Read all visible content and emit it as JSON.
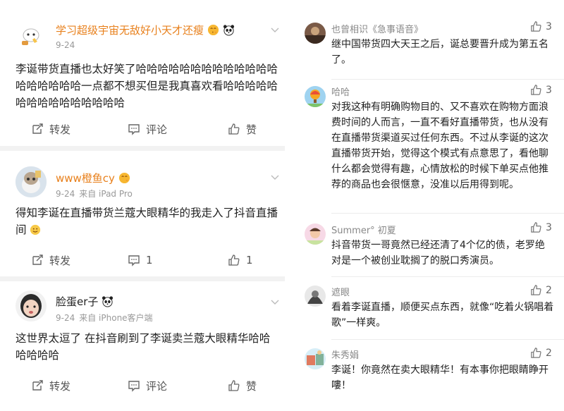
{
  "posts": [
    {
      "username": "学习超级宇宙无敌好小天才还瘦",
      "date": "9-24",
      "source": "",
      "content": "李诞带货直播也太好笑了哈哈哈哈哈哈哈哈哈哈哈哈哈哈哈哈哈哈哈一点都不想买但是我真喜欢看哈哈哈哈哈哈哈哈哈哈哈哈哈哈哈",
      "repost_label": "转发",
      "comment_label": "评论",
      "like_label": "赞"
    },
    {
      "username": "www橙鱼cy",
      "date": "9-24",
      "source": "来自 iPad Pro",
      "content": "得知李诞在直播带货兰蔻大眼精华的我走入了抖音直播间",
      "repost_label": "转发",
      "comment_label": "1",
      "like_label": "1"
    },
    {
      "username": "脸蛋er子",
      "date": "9-24",
      "source": "来自 iPhone客户端",
      "content": "这世界太逗了 在抖音刷到了李诞卖兰蔻大眼精华哈哈哈哈哈哈",
      "repost_label": "转发",
      "comment_label": "评论",
      "like_label": "赞"
    }
  ],
  "comments": [
    {
      "name": "也曾相识《急事语音》",
      "likes": "3",
      "text": "继中国带货四大天王之后，诞总要晋升成为第五名了。"
    },
    {
      "name": "哈哈",
      "likes": "3",
      "text": "对我这种有明确购物目的、又不喜欢在购物方面浪费时间的人而言，一直不看好直播带货，也从没有在直播带货渠道买过任何东西。不过从李诞的这次直播带货开始，觉得这个模式有点意思了，看他聊什么都会觉得有趣，心情放松的时候下单买点他推荐的商品也会很惬意，没准以后用得到呢。"
    },
    {
      "name": "Summer° 初夏",
      "likes": "3",
      "text": "抖音带货一哥竟然已经还清了4个亿的债，老罗绝对是一个被创业耽搁了的脱口秀演员。"
    },
    {
      "name": "遮眼",
      "likes": "2",
      "text": "看着李诞直播，顺便买点东西，就像“吃着火锅唱着歌”一样爽。"
    },
    {
      "name": "朱秀娟",
      "likes": "2",
      "text": "李诞！你竟然在卖大眼精华！有本事你把眼睛睁开嘍！"
    }
  ],
  "colors": {
    "username_orange": "#e8801c",
    "meta_gray": "#999999",
    "divider": "#f2f2f2"
  }
}
